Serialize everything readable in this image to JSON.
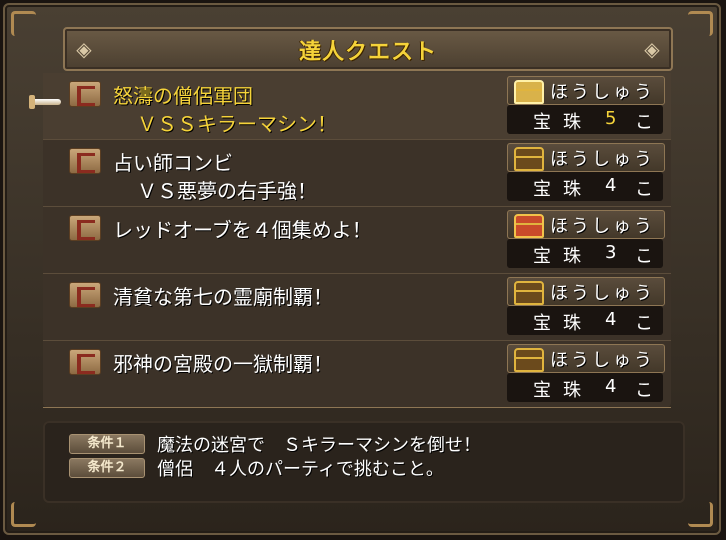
{
  "title": "達人クエスト",
  "quests": [
    {
      "name_line1": "怒濤の僧侶軍団",
      "name_line2": "ＶＳＳキラーマシン！",
      "reward_label": "ほうしゅう",
      "reward_item": "宝珠",
      "reward_count": "5",
      "reward_unit": "こ",
      "chest": "gold-chest-icon"
    },
    {
      "name_line1": "占い師コンビ",
      "name_line2": "ＶＳ悪夢の右手強！",
      "reward_label": "ほうしゅう",
      "reward_item": "宝珠",
      "reward_count": "4",
      "reward_unit": "こ",
      "chest": "brown-chest-icon"
    },
    {
      "name_line1": "レッドオーブを４個集めよ！",
      "name_line2": "",
      "reward_label": "ほうしゅう",
      "reward_item": "宝珠",
      "reward_count": "3",
      "reward_unit": "こ",
      "chest": "red-chest-icon"
    },
    {
      "name_line1": "清貧な第七の霊廟制覇！",
      "name_line2": "",
      "reward_label": "ほうしゅう",
      "reward_item": "宝珠",
      "reward_count": "4",
      "reward_unit": "こ",
      "chest": "brown-chest-icon"
    },
    {
      "name_line1": "邪神の宮殿の一獄制覇！",
      "name_line2": "",
      "reward_label": "ほうしゅう",
      "reward_item": "宝珠",
      "reward_count": "4",
      "reward_unit": "こ",
      "chest": "brown-chest-icon"
    }
  ],
  "conditions": [
    {
      "badge": "条件１",
      "text": "魔法の迷宮で　Ｓキラーマシンを倒せ！"
    },
    {
      "badge": "条件２",
      "text": "僧侶　４人のパーティで挑むこと。"
    }
  ],
  "colors": {
    "selected_text": "#f5d33a",
    "normal_text": "#ffffff",
    "panel": "#3c3228"
  }
}
